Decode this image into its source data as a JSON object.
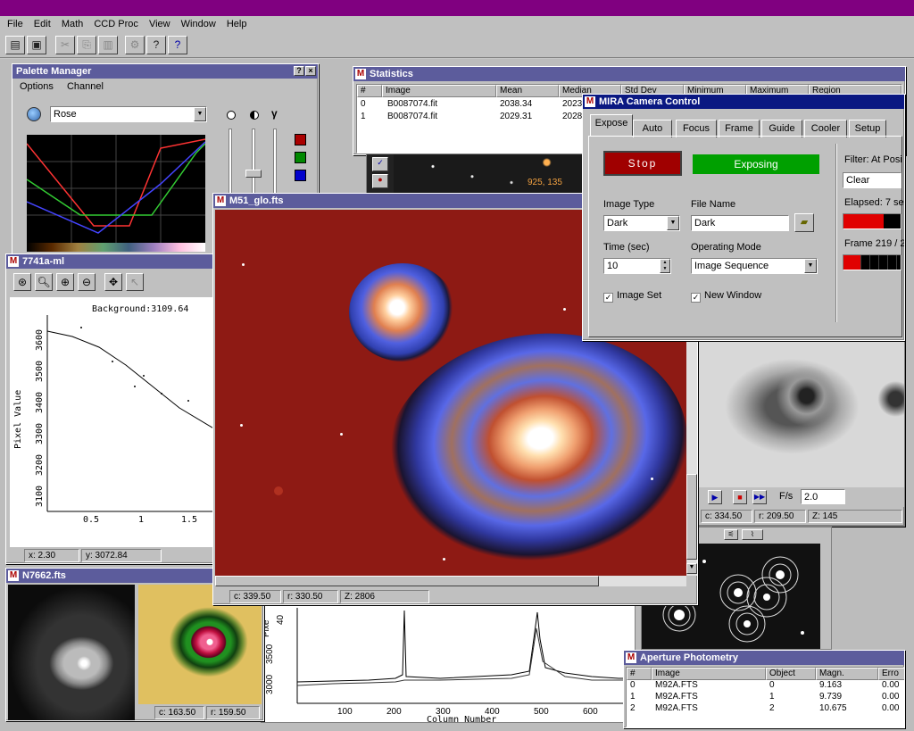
{
  "app": {
    "title": "",
    "menu": [
      "File",
      "Edit",
      "Math",
      "CCD Proc",
      "View",
      "Window",
      "Help"
    ]
  },
  "colors": {
    "title_active": "#0a1882",
    "title_inactive": "#5c5c9c",
    "accent": "#800080",
    "stop": "#a00000",
    "exposing": "#00a000"
  },
  "toolbar": {
    "icons": [
      "open-icon",
      "save-icon",
      "cut-icon",
      "copy-icon",
      "paste-icon",
      "settings-icon",
      "help-icon",
      "whats-this-icon"
    ]
  },
  "palette": {
    "title": "Palette Manager",
    "menu": [
      "Options",
      "Channel"
    ],
    "palette_name": "Rose"
  },
  "statistics": {
    "title": "Statistics",
    "columns": [
      "#",
      "Image",
      "Mean",
      "Median",
      "Std Dev",
      "Minimum",
      "Maximum",
      "Region"
    ],
    "rows": [
      {
        "n": "0",
        "image": "B0087074.fit",
        "mean": "2038.34",
        "median": "2023"
      },
      {
        "n": "1",
        "image": "B0087074.fit",
        "mean": "2029.31",
        "median": "2028"
      }
    ],
    "coord_label": "925, 135"
  },
  "camera": {
    "title": "MIRA Camera Control",
    "tabs": [
      "Expose",
      "Auto",
      "Focus",
      "Frame",
      "Guide",
      "Cooler",
      "Setup"
    ],
    "active_tab": "Expose",
    "stop_label": "Stop",
    "status_label": "Exposing",
    "image_type_label": "Image Type",
    "image_type": "Dark",
    "file_name_label": "File Name",
    "file_name": "Dark",
    "time_label": "Time (sec)",
    "time": "10",
    "operating_mode_label": "Operating Mode",
    "operating_mode": "Image Sequence",
    "image_set_label": "Image Set",
    "new_window_label": "New Window",
    "filter_label": "Filter: At Posi",
    "filter": "Clear",
    "elapsed_label": "Elapsed: 7 se",
    "frame_label": "Frame 219 / 2",
    "elapsed_progress": 0.7,
    "frame_progress": 0.3
  },
  "plot": {
    "title": "7741a-ml",
    "background_label": "Background:3109.64",
    "ylabel": "Pixel Value",
    "yticks": [
      "3100",
      "3200",
      "3300",
      "3400",
      "3500",
      "3600"
    ],
    "xticks": [
      "0.5",
      "1",
      "1.5"
    ],
    "status_x": "x: 2.30",
    "status_y": "y: 3072.84"
  },
  "m51": {
    "title": "M51_glo.fts",
    "status_c": "c: 339.50",
    "status_r": "r: 330.50",
    "status_z": "Z: 2806"
  },
  "galaxy_gray": {
    "fps_label": "F/s",
    "fps": "2.0",
    "status_c": "c: 334.50",
    "status_r": "r: 209.50",
    "status_z": "Z: 145"
  },
  "n7662": {
    "title": "N7662.fts",
    "status_c": "c: 163.50",
    "status_r": "r: 159.50"
  },
  "spectrum": {
    "xlabel": "Column Number",
    "ylabel": "Pixe",
    "xticks": [
      "100",
      "200",
      "300",
      "400",
      "500",
      "600"
    ],
    "yticks": [
      "3000",
      "3500",
      "40"
    ]
  },
  "aperture": {
    "title": "Aperture Photometry",
    "columns": [
      "#",
      "Image",
      "Object",
      "Magn.",
      "Erro"
    ],
    "rows": [
      {
        "n": "0",
        "image": "M92A.FTS",
        "object": "0",
        "magn": "9.163",
        "err": "0.00"
      },
      {
        "n": "1",
        "image": "M92A.FTS",
        "object": "1",
        "magn": "9.739",
        "err": "0.00"
      },
      {
        "n": "2",
        "image": "M92A.FTS",
        "object": "2",
        "magn": "10.675",
        "err": "0.00"
      }
    ]
  }
}
